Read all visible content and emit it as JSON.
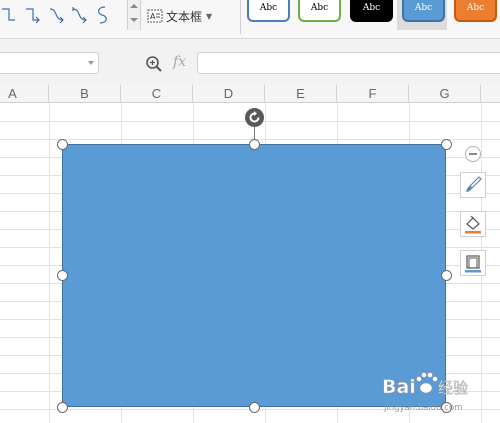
{
  "ribbon": {
    "connector_shapes": [
      "elbow-connector",
      "elbow-connector-arrow",
      "curved-connector",
      "curved-connector-arrow",
      "s-connector"
    ],
    "textbox_label": "文本框",
    "shape_styles": [
      {
        "label": "Abc",
        "border": "#4a7ebb",
        "fill": "#ffffff",
        "text": "#000000"
      },
      {
        "label": "Abc",
        "border": "#70ad47",
        "fill": "#ffffff",
        "text": "#000000"
      },
      {
        "label": "Abc",
        "border": "#000000",
        "fill": "#000000",
        "text": "#ffffff"
      },
      {
        "label": "Abc",
        "border": "#3e72a8",
        "fill": "#5b9bd5",
        "text": "#ffffff"
      },
      {
        "label": "Abc",
        "border": "#c55a11",
        "fill": "#ed7d31",
        "text": "#ffffff"
      }
    ]
  },
  "formula_bar": {
    "name_box_value": "",
    "fx_label": "fx",
    "formula_value": ""
  },
  "columns": [
    "A",
    "B",
    "C",
    "D",
    "E",
    "F",
    "G"
  ],
  "shape": {
    "type": "rectangle",
    "fill": "#5b9bd5",
    "outline": "#41719c"
  },
  "float_tools": [
    "collapse-icon",
    "brush-icon",
    "fill-bucket-icon",
    "outline-icon"
  ],
  "watermark": {
    "brand_left": "Bai",
    "brand_right": "经验",
    "url": "jingyan.baidu.com"
  }
}
